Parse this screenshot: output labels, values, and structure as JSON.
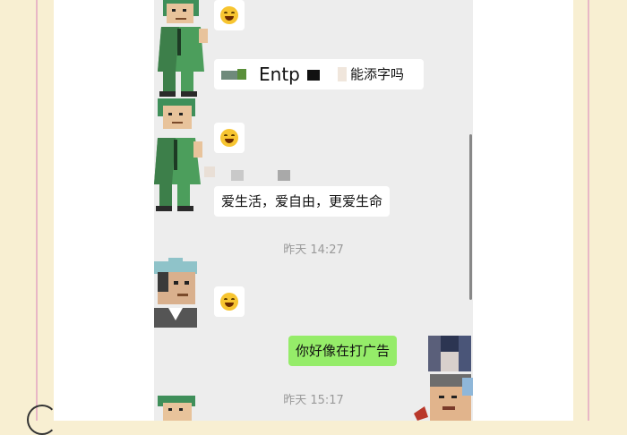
{
  "chat": {
    "messages": [
      {
        "id": "m1",
        "type": "emoji",
        "emoji": "laughing-face"
      },
      {
        "id": "m2",
        "type": "text",
        "text_mid": "Entp",
        "text_tail": "能添字吗"
      },
      {
        "id": "m3",
        "type": "emoji",
        "emoji": "laughing-face"
      },
      {
        "id": "m4",
        "type": "text",
        "text": "爱生活，爱自由，更爱生命"
      },
      {
        "id": "m5",
        "type": "emoji",
        "emoji": "laughing-face"
      },
      {
        "id": "m6",
        "type": "text",
        "text": "你好像在打广告",
        "outgoing": true
      }
    ],
    "timestamps": [
      "昨天 14:27",
      "昨天 15:17"
    ]
  },
  "colors": {
    "page_bg": "#f8efd2",
    "chat_bg": "#ededed",
    "outgoing_bubble": "#95ec69",
    "incoming_bubble": "#ffffff",
    "timestamp_text": "#9a9a9a"
  }
}
